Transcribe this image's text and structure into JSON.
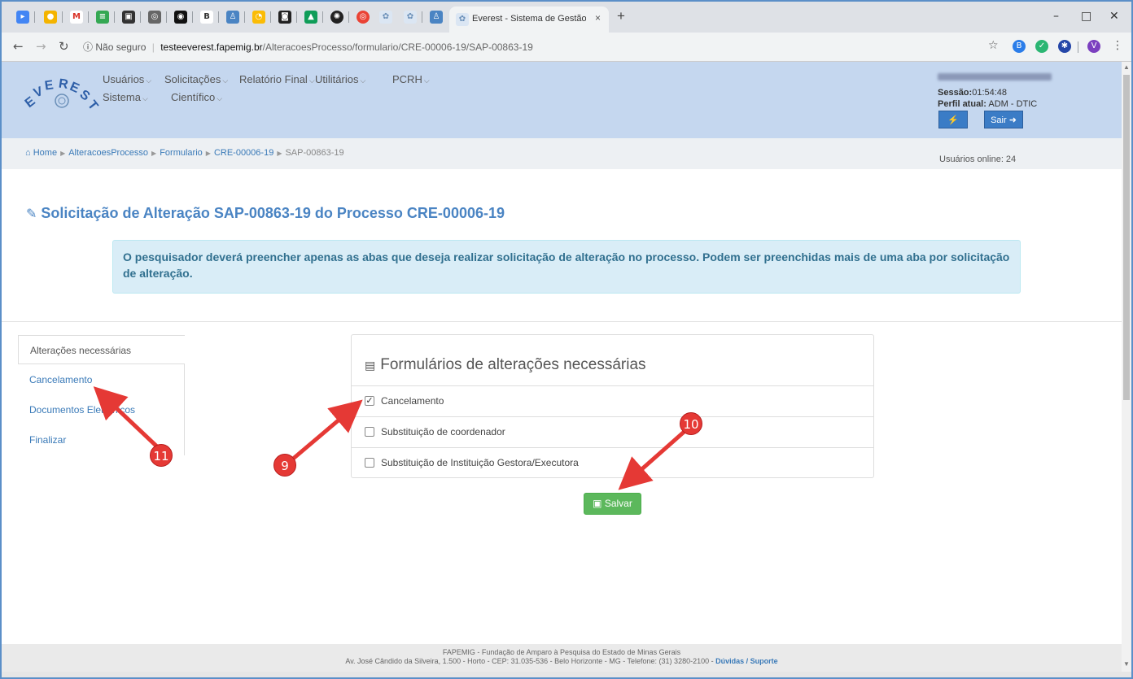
{
  "browser": {
    "tab_title": "Everest - Sistema de Gestão da F",
    "tab_close": "×",
    "new_tab": "+",
    "security": "Não seguro",
    "url_domain": "testeeverest.fapemig.br",
    "url_path": "/AlteracoesProcesso/formulario/CRE-00006-19/SAP-00863-19",
    "profile_initial": "V",
    "window_controls": {
      "minimize": "–",
      "maximize": "□",
      "close": "✕"
    }
  },
  "header": {
    "logo_text": "EVEREST",
    "menu": [
      {
        "label": "Usuários"
      },
      {
        "label": "Solicitações"
      },
      {
        "label": "Relatório Final"
      },
      {
        "label": "Utilitários"
      },
      {
        "label": "PCRH"
      },
      {
        "label": "Sistema"
      },
      {
        "label": "Científico"
      }
    ],
    "session_label": "Sessão:",
    "session_value": "01:54:48",
    "profile_label": "Perfil atual:",
    "profile_value": "ADM - DTIC",
    "flash_icon": "⚡",
    "logout_label": "Sair"
  },
  "breadcrumb": {
    "items": [
      "Home",
      "AlteracoesProcesso",
      "Formulario",
      "CRE-00006-19",
      "SAP-00863-19"
    ],
    "online_label": "Usuários online: 24"
  },
  "page": {
    "title": "Solicitação de Alteração SAP-00863-19 do Processo CRE-00006-19",
    "alert": "O pesquisador deverá preencher apenas as abas que deseja realizar solicitação de alteração no processo. Podem ser preenchidas mais de uma aba por solicitação de alteração."
  },
  "sidenav": {
    "items": [
      {
        "label": "Alterações necessárias"
      },
      {
        "label": "Cancelamento"
      },
      {
        "label": "Documentos Eletrônicos"
      },
      {
        "label": "Finalizar"
      }
    ]
  },
  "panel": {
    "title": "Formulários de alterações necessárias",
    "options": [
      {
        "label": "Cancelamento",
        "checked": true
      },
      {
        "label": "Substituição de coordenador",
        "checked": false
      },
      {
        "label": "Substituição de Instituição Gestora/Executora",
        "checked": false
      }
    ],
    "save_label": "Salvar"
  },
  "annotations": {
    "badge_9": "9",
    "badge_10": "10",
    "badge_11": "11"
  },
  "footer": {
    "line1": "FAPEMIG - Fundação de Amparo à Pesquisa do Estado de Minas Gerais",
    "line2": "Av. José Cândido da Silveira, 1.500 - Horto - CEP: 31.035-536 - Belo Horizonte - MG - Telefone: (31) 3280-2100 -",
    "support_link": "Dúvidas / Suporte"
  },
  "colors": {
    "header_bg": "#c5d7ef",
    "accent_blue": "#4a84c3",
    "save_green": "#5cb85c",
    "alert_bg": "#d9edf7",
    "annotation_red": "#e53935"
  }
}
